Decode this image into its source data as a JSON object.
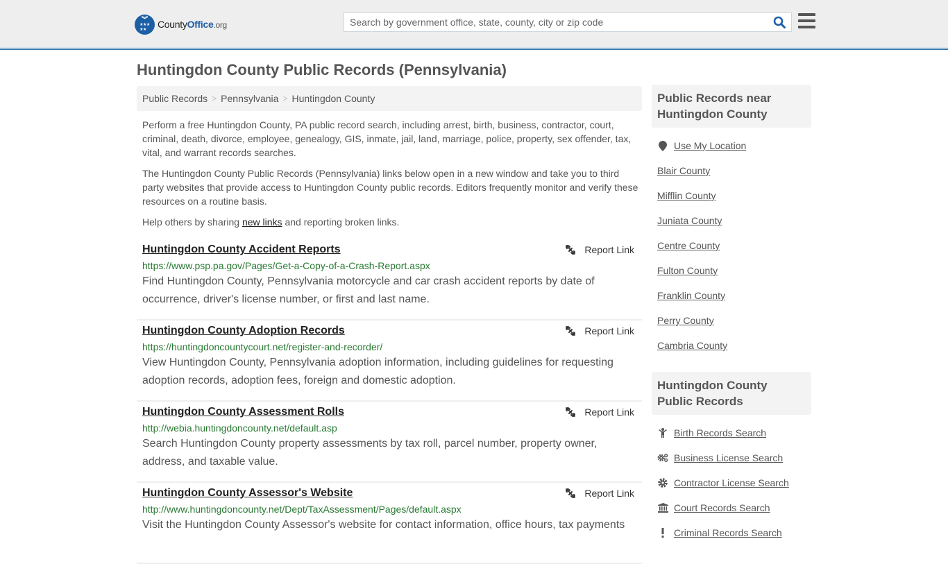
{
  "header": {
    "logo": {
      "brand_prefix": "County",
      "brand_main": "Office",
      "brand_tld": ".org"
    },
    "search": {
      "placeholder": "Search by government office, state, county, city or zip code",
      "value": ""
    },
    "icons": {
      "search": "search-icon",
      "menu": "hamburger-menu-icon"
    }
  },
  "page": {
    "title": "Huntingdon County Public Records (Pennsylvania)",
    "breadcrumb": [
      "Public Records",
      "Pennsylvania",
      "Huntingdon County"
    ],
    "breadcrumb_separator": ">",
    "intro": {
      "p1": "Perform a free Huntingdon County, PA public record search, including arrest, birth, business, contractor, court, criminal, death, divorce, employee, genealogy, GIS, inmate, jail, land, marriage, police, property, sex offender, tax, vital, and warrant records searches.",
      "p2": "The Huntingdon County Public Records (Pennsylvania) links below open in a new window and take you to third party websites that provide access to Huntingdon County public records. Editors frequently monitor and verify these resources on a routine basis.",
      "p3_before": "Help others by sharing ",
      "p3_link": "new links",
      "p3_after": " and reporting broken links."
    },
    "report_label": "Report Link",
    "records": [
      {
        "title": "Huntingdon County Accident Reports",
        "url": "https://www.psp.pa.gov/Pages/Get-a-Copy-of-a-Crash-Report.aspx",
        "description": "Find Huntingdon County, Pennsylvania motorcycle and car crash accident reports by date of occurrence, driver's license number, or first and last name."
      },
      {
        "title": "Huntingdon County Adoption Records",
        "url": "https://huntingdoncountycourt.net/register-and-recorder/",
        "description": "View Huntingdon County, Pennsylvania adoption information, including guidelines for requesting adoption records, adoption fees, foreign and domestic adoption."
      },
      {
        "title": "Huntingdon County Assessment Rolls",
        "url": "http://webia.huntingdoncounty.net/default.asp",
        "description": "Search Huntingdon County property assessments by tax roll, parcel number, property owner, address, and taxable value."
      },
      {
        "title": "Huntingdon County Assessor's Website",
        "url": "http://www.huntingdoncounty.net/Dept/TaxAssessment/Pages/default.aspx",
        "description": "Visit the Huntingdon County Assessor's website for contact information, office hours, tax payments"
      }
    ]
  },
  "sidebar": {
    "nearby": {
      "heading": "Public Records near Huntingdon County",
      "use_location": "Use My Location",
      "counties": [
        "Blair County",
        "Mifflin County",
        "Juniata County",
        "Centre County",
        "Fulton County",
        "Franklin County",
        "Perry County",
        "Cambria County"
      ]
    },
    "county_records": {
      "heading": "Huntingdon County Public Records",
      "items": [
        {
          "label": "Birth Records Search",
          "icon": "child-icon"
        },
        {
          "label": "Business License Search",
          "icon": "gears-icon"
        },
        {
          "label": "Contractor License Search",
          "icon": "gear-icon"
        },
        {
          "label": "Court Records Search",
          "icon": "courthouse-icon"
        },
        {
          "label": "Criminal Records Search",
          "icon": "exclamation-icon"
        }
      ]
    }
  },
  "colors": {
    "brand_blue": "#1d5fa5",
    "url_green": "#2a7a33",
    "header_border": "#3a7cb0"
  }
}
